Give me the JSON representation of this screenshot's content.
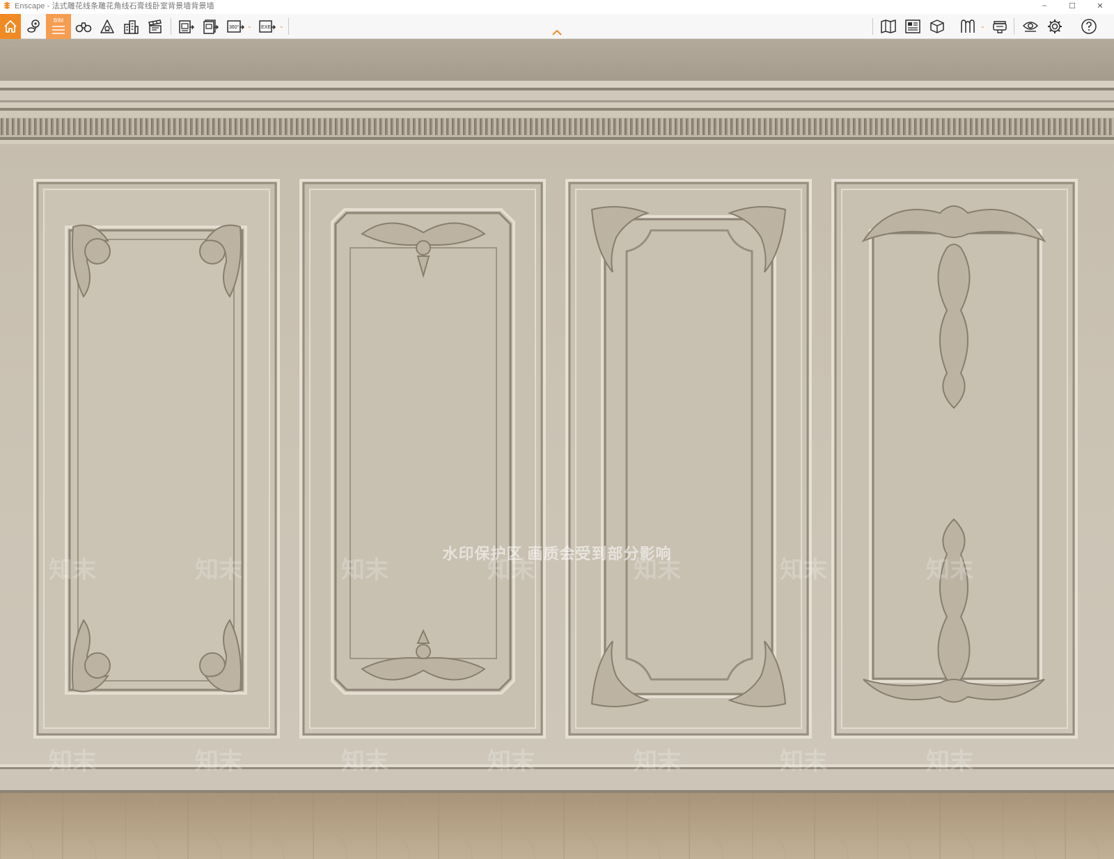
{
  "window": {
    "app_name": "Enscape",
    "title": "Enscape - 法式雕花线条雕花角线石膏线卧室背景墙背景墙",
    "controls": {
      "minimize": "–",
      "maximize": "☐",
      "close": "✕"
    }
  },
  "toolbar": {
    "left_buttons": [
      {
        "icon": "home-icon"
      },
      {
        "icon": "map-pin-icon"
      },
      {
        "icon": "bim-icon",
        "label": "BIM"
      },
      {
        "icon": "binoculars-icon"
      },
      {
        "icon": "mountain-view-icon"
      },
      {
        "icon": "buildings-icon"
      },
      {
        "icon": "clapperboard-icon"
      },
      {
        "icon": "screenshot-export-icon"
      },
      {
        "icon": "batch-render-icon"
      },
      {
        "icon": "panorama-360-icon",
        "label": "360°"
      },
      {
        "icon": "exe-export-icon",
        "label": "EXE"
      }
    ],
    "right_buttons": [
      {
        "icon": "map-icon"
      },
      {
        "icon": "asset-library-icon"
      },
      {
        "icon": "cube-view-icon"
      },
      {
        "icon": "materials-icon"
      },
      {
        "icon": "vr-headset-icon"
      },
      {
        "icon": "eye-icon"
      },
      {
        "icon": "settings-gear-icon"
      },
      {
        "icon": "help-icon"
      }
    ]
  },
  "viewport": {
    "watermark_notice": "水印保护区   画质会受到部分影响",
    "watermark_brand": "知末"
  },
  "colors": {
    "accent": "#f08a24",
    "wall": "#cbc3b4",
    "molding_shadow": "#8f8677",
    "floor": "#b7a48a"
  }
}
